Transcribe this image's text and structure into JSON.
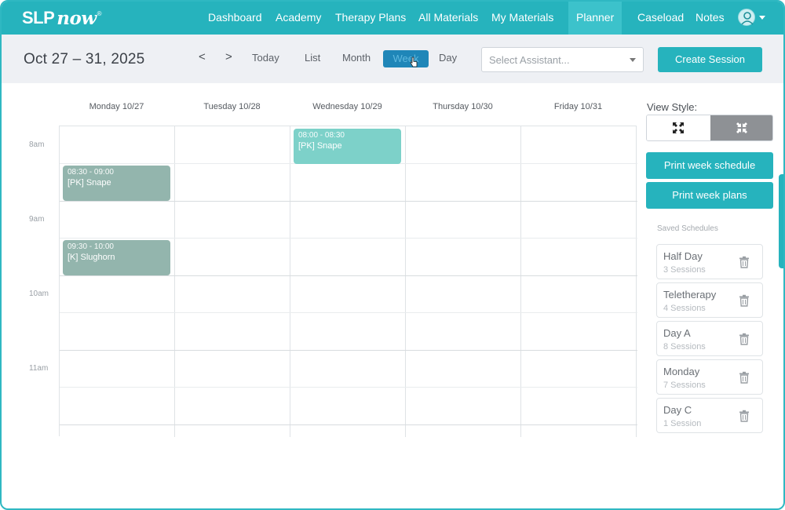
{
  "brand": {
    "logo_slp": "SLP",
    "logo_now": "now",
    "logo_mark": "®"
  },
  "nav": {
    "items": [
      {
        "label": "Dashboard"
      },
      {
        "label": "Academy"
      },
      {
        "label": "Therapy Plans"
      },
      {
        "label": "All Materials"
      },
      {
        "label": "My Materials"
      },
      {
        "label": "Planner",
        "active": true
      },
      {
        "label": "Caseload"
      },
      {
        "label": "Notes"
      }
    ]
  },
  "toolbar": {
    "date_range": "Oct 27 – 31, 2025",
    "prev": "<",
    "next": ">",
    "today": "Today",
    "list": "List",
    "month": "Month",
    "week": "Week",
    "day": "Day",
    "assistant_placeholder": "Select Assistant...",
    "create_session": "Create Session"
  },
  "calendar": {
    "days": [
      "Monday 10/27",
      "Tuesday 10/28",
      "Wednesday 10/29",
      "Thursday 10/30",
      "Friday 10/31"
    ],
    "times": [
      "8am",
      "9am",
      "10am",
      "11am"
    ],
    "events": [
      {
        "day": 0,
        "start": "08:30",
        "end": "09:00",
        "time": "08:30 - 09:00",
        "name": "[PK] Snape",
        "color": "#93b5ad"
      },
      {
        "day": 0,
        "start": "09:30",
        "end": "10:00",
        "time": "09:30 - 10:00",
        "name": "[K] Slughorn",
        "color": "#93b5ad"
      },
      {
        "day": 2,
        "start": "08:00",
        "end": "08:30",
        "time": "08:00 - 08:30",
        "name": "[PK] Snape",
        "color": "#7dd1c9"
      }
    ]
  },
  "panel": {
    "view_style_label": "View Style:",
    "print_schedule": "Print week schedule",
    "print_plans": "Print week plans",
    "saved_label": "Saved Schedules",
    "saved": [
      {
        "name": "Half Day",
        "count": "3 Sessions"
      },
      {
        "name": "Teletherapy",
        "count": "4 Sessions"
      },
      {
        "name": "Day A",
        "count": "8 Sessions"
      },
      {
        "name": "Monday",
        "count": "7 Sessions"
      },
      {
        "name": "Day C",
        "count": "1 Session"
      }
    ]
  },
  "colors": {
    "accent": "#26b3bd",
    "week_active": "#1f86b8"
  }
}
